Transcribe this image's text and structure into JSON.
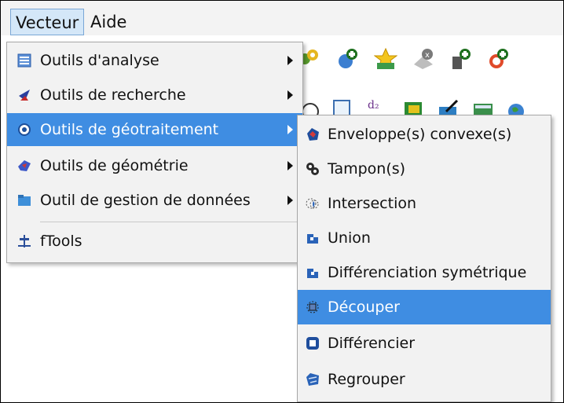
{
  "menubar": {
    "items": [
      {
        "label": "Vecteur"
      },
      {
        "label": "Aide"
      }
    ]
  },
  "vector_menu": {
    "items": [
      {
        "label": "Outils d'analyse",
        "icon": "analysis-tools-icon"
      },
      {
        "label": "Outils de recherche",
        "icon": "research-tools-icon"
      },
      {
        "label": "Outils de géotraitement",
        "icon": "geoprocessing-tools-icon"
      },
      {
        "label": "Outils de géométrie",
        "icon": "geometry-tools-icon"
      },
      {
        "label": "Outil de gestion de données",
        "icon": "data-management-icon"
      },
      {
        "label": "fTools",
        "icon": "ftools-icon"
      }
    ]
  },
  "geoprocessing_menu": {
    "items": [
      {
        "label": "Enveloppe(s) convexe(s)",
        "icon": "convex-hull-icon"
      },
      {
        "label": "Tampon(s)",
        "icon": "buffer-icon"
      },
      {
        "label": "Intersection",
        "icon": "intersection-icon"
      },
      {
        "label": "Union",
        "icon": "union-icon"
      },
      {
        "label": "Différenciation symétrique",
        "icon": "symmetric-difference-icon"
      },
      {
        "label": "Découper",
        "icon": "clip-icon"
      },
      {
        "label": "Différencier",
        "icon": "difference-icon"
      },
      {
        "label": "Regrouper",
        "icon": "dissolve-icon"
      }
    ]
  },
  "colors": {
    "highlight": "#3f8de2",
    "menu_bg": "#f2f2f2"
  }
}
